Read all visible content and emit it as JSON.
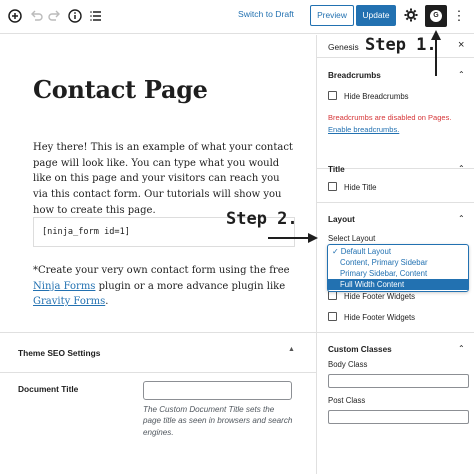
{
  "toolbar": {
    "icons": [
      "add-icon",
      "undo-icon",
      "redo-icon",
      "info-icon",
      "list-view-icon",
      "gear-icon",
      "genesis-icon",
      "more-icon"
    ],
    "switch_to_draft": "Switch to Draft",
    "preview": "Preview",
    "update": "Update",
    "genesis_glyph": "G",
    "more_glyph": "⋮"
  },
  "editor": {
    "title": "Contact Page",
    "intro": "Hey there! This is an example of what your contact page will look like. You can type what you would like on this page and your visitors can reach you via this contact form. Our tutorials will show you how to create this page.",
    "shortcode": "[ninja_form id=1]",
    "para2_start": "*Create your very own contact form using the free ",
    "link_ninja": "Ninja Forms",
    "para2_mid": " plugin or a more advance plugin like ",
    "link_gravity": "Gravity Forms",
    "para2_end": "."
  },
  "seo": {
    "title": "Theme SEO Settings",
    "caret": "▲",
    "document_title_label": "Document Title",
    "document_title_value": "",
    "document_title_help": "The Custom Document Title sets the page title as seen in browsers and search engines."
  },
  "sidebar": {
    "tab": "Genesis",
    "close": "×",
    "breadcrumbs": {
      "title": "Breadcrumbs",
      "checkbox": "Hide Breadcrumbs",
      "warning": "Breadcrumbs are disabled on Pages.",
      "link": "Enable breadcrumbs."
    },
    "title_section": {
      "title": "Title",
      "checkbox": "Hide Title"
    },
    "layout": {
      "title": "Layout",
      "select_label": "Select Layout",
      "options": [
        "✓ Default Layout",
        "Content, Primary Sidebar",
        "Primary Sidebar, Content",
        "Full Width Content"
      ],
      "highlighted_option": "Full Width Content"
    },
    "footer": {
      "checkbox_partial": "Hide Footer Widgets",
      "checkbox": "Hide Footer Widgets"
    },
    "custom_classes": {
      "title": "Custom Classes",
      "body_class": "Body Class",
      "post_class": "Post Class"
    },
    "caret_up": "⌃"
  },
  "annotations": {
    "step1": "Step 1.",
    "step2": "Step 2."
  },
  "colors": {
    "accent": "#2271b1",
    "warning": "#d63638",
    "dark": "#1e1e1e"
  }
}
